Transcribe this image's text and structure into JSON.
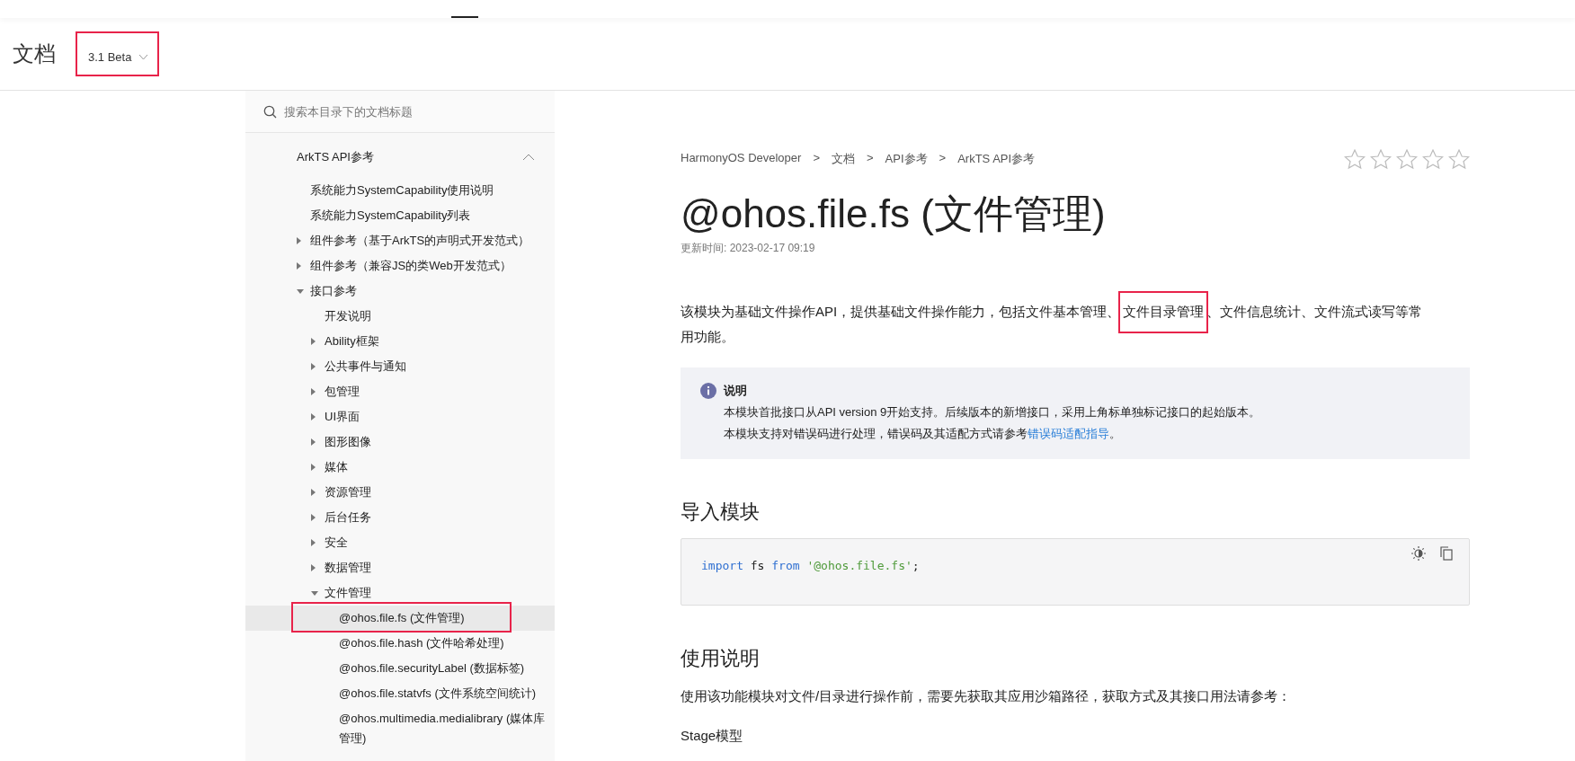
{
  "header": {
    "title": "文档",
    "version": {
      "label": "3.1 Beta",
      "highlighted": true
    }
  },
  "sidebar": {
    "search": {
      "placeholder": "搜索本目录下的文档标题"
    },
    "section": {
      "label": "ArkTS API参考",
      "expanded": true,
      "children": [
        {
          "label": "系统能力SystemCapability使用说明",
          "selected": false,
          "highlighted": false
        },
        {
          "label": "系统能力SystemCapability列表",
          "selected": false,
          "highlighted": false
        },
        {
          "label": "组件参考（基于ArkTS的声明式开发范式）",
          "expanded": false,
          "selected": false,
          "highlighted": false
        },
        {
          "label": "组件参考（兼容JS的类Web开发范式）",
          "expanded": false,
          "selected": false,
          "highlighted": false
        },
        {
          "label": "接口参考",
          "expanded": true,
          "selected": false,
          "highlighted": false,
          "children": [
            {
              "label": "开发说明",
              "selected": false,
              "highlighted": false
            },
            {
              "label": "Ability框架",
              "expanded": false,
              "selected": false,
              "highlighted": false
            },
            {
              "label": "公共事件与通知",
              "expanded": false,
              "selected": false,
              "highlighted": false
            },
            {
              "label": "包管理",
              "expanded": false,
              "selected": false,
              "highlighted": false
            },
            {
              "label": "UI界面",
              "expanded": false,
              "selected": false,
              "highlighted": false
            },
            {
              "label": "图形图像",
              "expanded": false,
              "selected": false,
              "highlighted": false
            },
            {
              "label": "媒体",
              "expanded": false,
              "selected": false,
              "highlighted": false
            },
            {
              "label": "资源管理",
              "expanded": false,
              "selected": false,
              "highlighted": false
            },
            {
              "label": "后台任务",
              "expanded": false,
              "selected": false,
              "highlighted": false
            },
            {
              "label": "安全",
              "expanded": false,
              "selected": false,
              "highlighted": false
            },
            {
              "label": "数据管理",
              "expanded": false,
              "selected": false,
              "highlighted": false
            },
            {
              "label": "文件管理",
              "expanded": true,
              "selected": false,
              "highlighted": false,
              "children": [
                {
                  "label": "@ohos.file.fs (文件管理)",
                  "selected": true,
                  "highlighted": true
                },
                {
                  "label": "@ohos.file.hash (文件哈希处理)",
                  "selected": false,
                  "highlighted": false
                },
                {
                  "label": "@ohos.file.securityLabel (数据标签)",
                  "selected": false,
                  "highlighted": false
                },
                {
                  "label": "@ohos.file.statvfs (文件系统空间统计)",
                  "selected": false,
                  "highlighted": false
                },
                {
                  "label": "@ohos.multimedia.medialibrary (媒体库管理)",
                  "selected": false,
                  "highlighted": false
                }
              ]
            }
          ]
        }
      ]
    }
  },
  "article": {
    "breadcrumb": [
      "HarmonyOS Developer",
      "文档",
      "API参考",
      "ArkTS API参考"
    ],
    "breadcrumb_separator": ">",
    "rating": {
      "stars": 0
    },
    "title": "@ohos.file.fs (文件管理)",
    "updated": "更新时间: 2023-02-17 09:19",
    "intro": {
      "before": "该模块为基础文件操作API，提供基础文件操作能力，包括文件基本管理、",
      "highlight": "文件目录管理",
      "after": "、文件信息统计、文件流式读写等常用功能。"
    },
    "note": {
      "title": "说明",
      "lines": [
        {
          "text": "本模块首批接口从API version 9开始支持。后续版本的新增接口，采用上角标单独标记接口的起始版本。"
        },
        {
          "text": "本模块支持对错误码进行处理，错误码及其适配方式请参考",
          "link": "错误码适配指导",
          "after": "。"
        }
      ]
    },
    "sections": [
      {
        "kind": "heading",
        "text": "导入模块"
      },
      {
        "kind": "code",
        "tokens": [
          {
            "kind": "keyword",
            "text": "import"
          },
          {
            "kind": "plain",
            "text": " fs "
          },
          {
            "kind": "keyword",
            "text": "from "
          },
          {
            "kind": "string",
            "text": "'@ohos.file.fs'"
          },
          {
            "kind": "plain",
            "text": ";"
          }
        ]
      },
      {
        "kind": "heading",
        "text": "使用说明"
      },
      {
        "kind": "paragraph",
        "text": "使用该功能模块对文件/目录进行操作前，需要先获取其应用沙箱路径，获取方式及其接口用法请参考："
      },
      {
        "kind": "subheading",
        "text": "Stage模型"
      }
    ]
  }
}
